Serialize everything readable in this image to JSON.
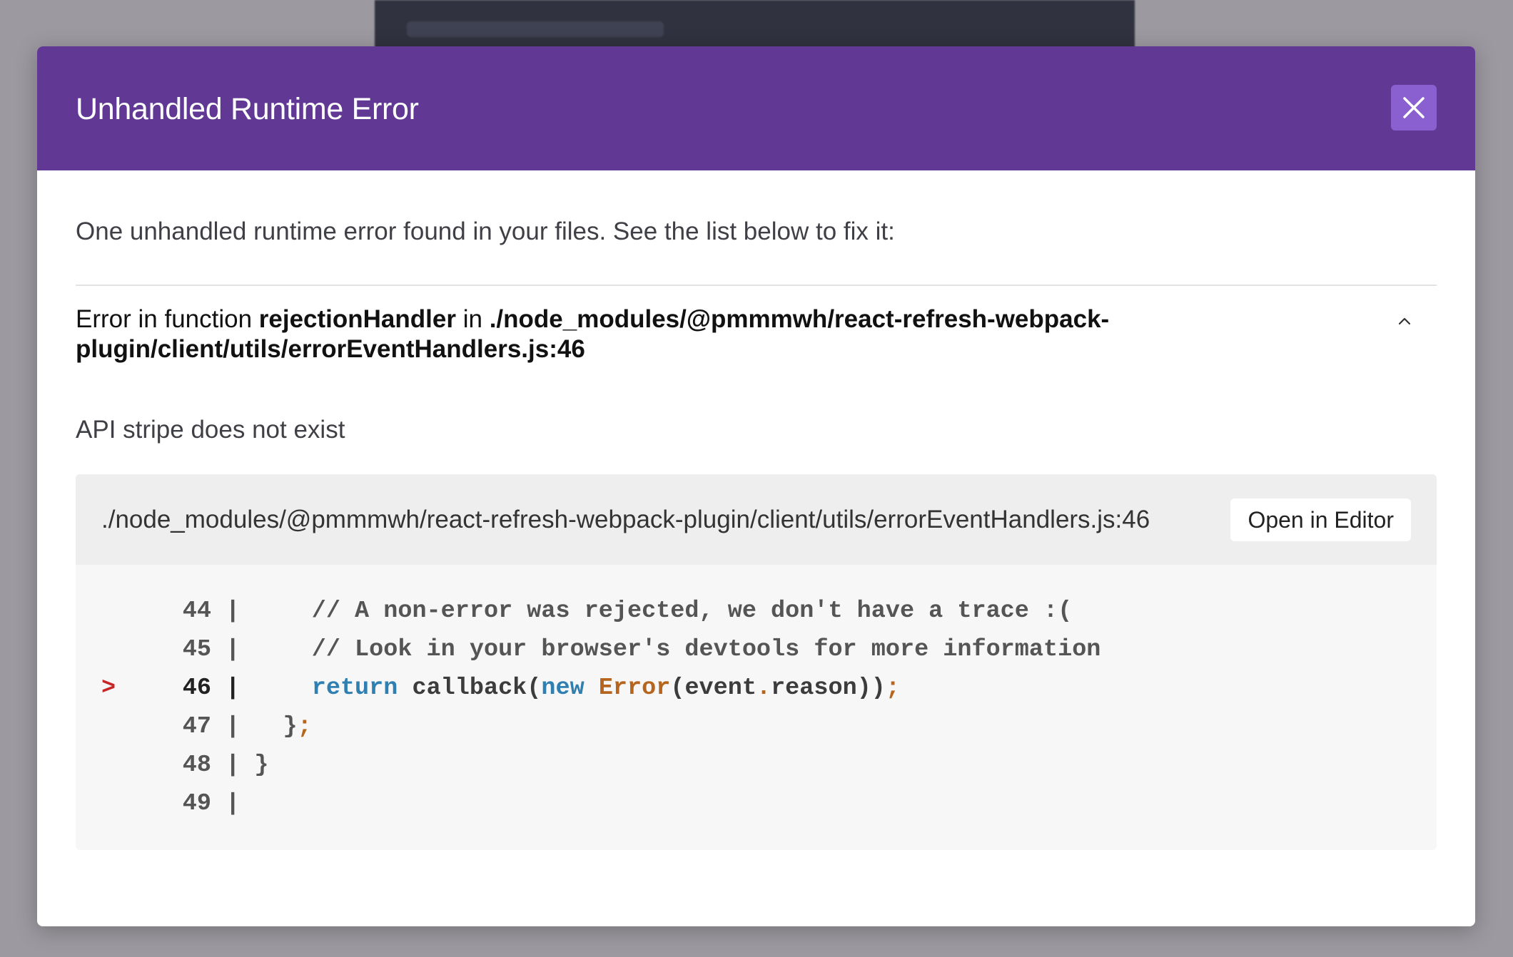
{
  "modal": {
    "title": "Unhandled Runtime Error",
    "summary": "One unhandled runtime error found in your files. See the list below to fix it:"
  },
  "error": {
    "heading_prefix": "Error in function ",
    "function_name": "rejectionHandler",
    "heading_in": " in ",
    "location": "./node_modules/@pmmmwh/react-refresh-webpack-plugin/client/utils/errorEventHandlers.js:46",
    "message": "API stripe does not exist"
  },
  "code_frame": {
    "path": "./node_modules/@pmmmwh/react-refresh-webpack-plugin/client/utils/errorEventHandlers.js:46",
    "open_label": "Open in Editor",
    "marker": ">",
    "lines": [
      {
        "num": "44",
        "code": "    // A non-error was rejected, we don't have a trace :("
      },
      {
        "num": "45",
        "code": "    // Look in your browser's devtools for more information"
      },
      {
        "num": "46",
        "code_kw1": "return",
        "code_call": " callback(",
        "code_kw2": "new",
        "code_cls": " Error",
        "code_args": "(event",
        "code_dot": ".",
        "code_rest": "reason))",
        "code_semi": ";"
      },
      {
        "num": "47",
        "code": "  }",
        "code_semi": ";"
      },
      {
        "num": "48",
        "code": "}"
      },
      {
        "num": "49",
        "code": ""
      }
    ]
  },
  "colors": {
    "header": "#613995",
    "close_button": "#8a60d1",
    "keyword": "#2f7fb0",
    "class_name": "#b5651d",
    "marker": "#c62828"
  },
  "icons": {
    "close": "close-icon",
    "collapse": "chevron-up-icon"
  }
}
